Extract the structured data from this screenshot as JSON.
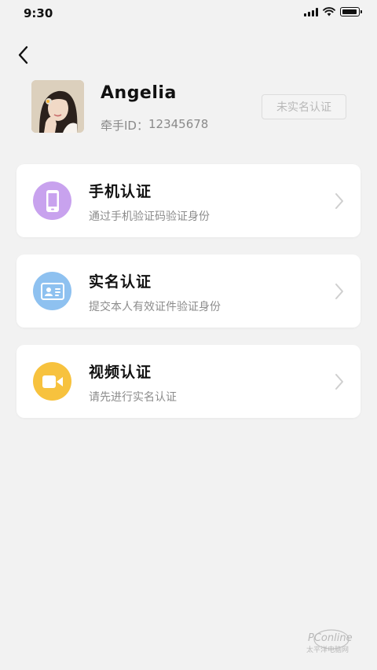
{
  "status_bar": {
    "time": "9:30"
  },
  "profile": {
    "name": "Angelia",
    "id_label": "牵手ID：",
    "id_value": "12345678",
    "status": "未实名认证"
  },
  "verification_items": [
    {
      "title": "手机认证",
      "subtitle": "通过手机验证码验证身份",
      "icon": "phone-icon",
      "color": "#c8a2ee"
    },
    {
      "title": "实名认证",
      "subtitle": "提交本人有效证件验证身份",
      "icon": "id-card-icon",
      "color": "#8ec1f0"
    },
    {
      "title": "视频认证",
      "subtitle": "请先进行实名认证",
      "icon": "video-camera-icon",
      "color": "#f7c23e"
    }
  ],
  "watermark": {
    "text": "PConline",
    "subtext": "太平洋电脑网"
  }
}
